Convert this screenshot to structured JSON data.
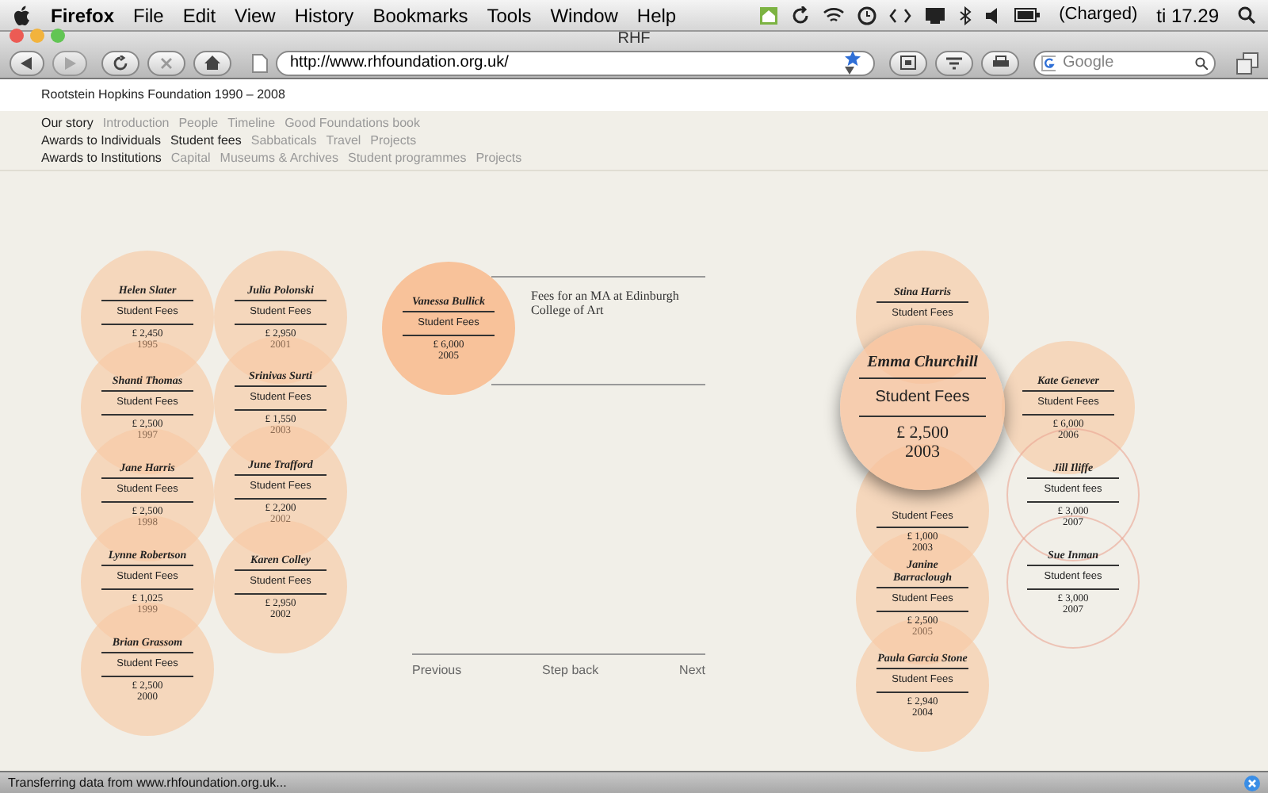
{
  "menu_bar": {
    "app": "Firefox",
    "items": [
      "File",
      "Edit",
      "View",
      "History",
      "Bookmarks",
      "Tools",
      "Window",
      "Help"
    ],
    "battery": "(Charged)",
    "clock": "ti 17.29"
  },
  "window": {
    "title": "RHF"
  },
  "toolbar": {
    "url": "http://www.rhfoundation.org.uk/",
    "search_placeholder": "Google"
  },
  "site_title": "Rootstein Hopkins Foundation 1990 – 2008",
  "nav": [
    {
      "section": "Our story",
      "items": [
        {
          "label": "Introduction",
          "selected": false
        },
        {
          "label": "People",
          "selected": false
        },
        {
          "label": "Timeline",
          "selected": false
        },
        {
          "label": "Good Foundations book",
          "selected": false
        }
      ]
    },
    {
      "section": "Awards to Individuals",
      "items": [
        {
          "label": "Student fees",
          "selected": true
        },
        {
          "label": "Sabbaticals",
          "selected": false
        },
        {
          "label": "Travel",
          "selected": false
        },
        {
          "label": "Projects",
          "selected": false
        }
      ]
    },
    {
      "section": "Awards to Institutions",
      "items": [
        {
          "label": "Capital",
          "selected": false
        },
        {
          "label": "Museums & Archives",
          "selected": false
        },
        {
          "label": "Student programmes",
          "selected": false
        },
        {
          "label": "Projects",
          "selected": false
        }
      ]
    }
  ],
  "awards": [
    {
      "kind": "filled",
      "name": "Helen Slater",
      "label": "Student Fees",
      "amount": "£ 2,450",
      "year": "1995",
      "year_dimmed": true
    },
    {
      "kind": "filled",
      "name": "Julia Polonski",
      "label": "Student Fees",
      "amount": "£ 2,950",
      "year": "2001",
      "year_dimmed": true
    },
    {
      "kind": "filled",
      "name": "Shanti Thomas",
      "label": "Student Fees",
      "amount": "£ 2,500",
      "year": "1997",
      "year_dimmed": true
    },
    {
      "kind": "filled",
      "name": "Srinivas Surti",
      "label": "Student Fees",
      "amount": "£ 1,550",
      "year": "2003",
      "year_dimmed": true
    },
    {
      "kind": "filled",
      "name": "Jane Harris",
      "label": "Student Fees",
      "amount": "£ 2,500",
      "year": "1998",
      "year_dimmed": true
    },
    {
      "kind": "filled",
      "name": "June Trafford",
      "label": "Student Fees",
      "amount": "£ 2,200",
      "year": "2002",
      "year_dimmed": true
    },
    {
      "kind": "filled",
      "name": "Lynne Robertson",
      "label": "Student Fees",
      "amount": "£ 1,025",
      "year": "1999",
      "year_dimmed": true
    },
    {
      "kind": "filled",
      "name": "Karen Colley",
      "label": "Student Fees",
      "amount": "£ 2,950",
      "year": "2002",
      "year_dimmed": false
    },
    {
      "kind": "filled",
      "name": "Brian Grassom",
      "label": "Student Fees",
      "amount": "£ 2,500",
      "year": "2000",
      "year_dimmed": false
    },
    {
      "kind": "filled",
      "name": "Stina Harris",
      "label": "Student Fees"
    },
    {
      "kind": "filled",
      "label": "Student Fees",
      "amount": "£ 1,000",
      "year": "2003",
      "year_dimmed": false
    },
    {
      "kind": "filled",
      "name": "Janine Barraclough",
      "label": "Student Fees",
      "amount": "£ 2,500",
      "year": "2005",
      "year_dimmed": true
    },
    {
      "kind": "filled",
      "name": "Paula Garcia Stone",
      "label": "Student Fees",
      "amount": "£ 2,940",
      "year": "2004",
      "year_dimmed": false
    },
    {
      "kind": "filled",
      "name": "Kate Genever",
      "label": "Student Fees",
      "amount": "£ 6,000",
      "year": "2006",
      "year_dimmed": false
    },
    {
      "kind": "outline",
      "name": "Jill Iliffe",
      "label": "Student fees",
      "amount": "£ 3,000",
      "year": "2007",
      "year_dimmed": false
    },
    {
      "kind": "outline",
      "name": "Sue Inman",
      "label": "Student fees",
      "amount": "£ 3,000",
      "year": "2007",
      "year_dimmed": false
    },
    {
      "kind": "focused",
      "name": "Emma Churchill",
      "label": "Student Fees",
      "amount": "£ 2,500",
      "year": "2003",
      "year_dimmed": false
    }
  ],
  "detail": {
    "name": "Vanessa Bullick",
    "label": "Student Fees",
    "amount": "£ 6,000",
    "year": "2005",
    "description": "Fees for an MA at Edinburgh College of Art"
  },
  "pager": [
    "Previous",
    "Step back",
    "Next"
  ],
  "status_bar": "Transferring data from www.rhfoundation.org.uk..."
}
